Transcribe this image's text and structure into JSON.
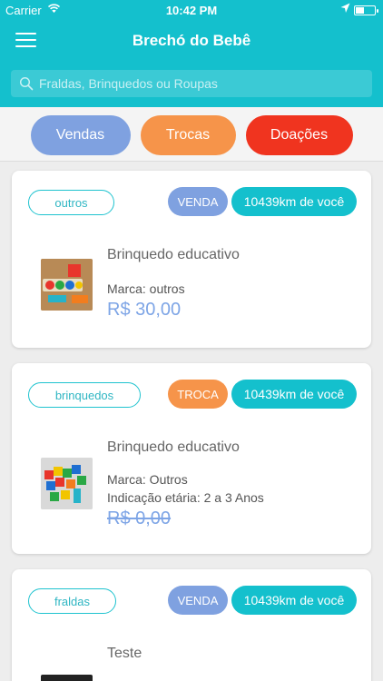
{
  "status_bar": {
    "carrier": "Carrier",
    "time": "10:42 PM"
  },
  "nav": {
    "title": "Brechó do Bebê",
    "menu_icon": "hamburger-menu-icon"
  },
  "search": {
    "placeholder": "Fraldas, Brinquedos ou Roupas",
    "value": ""
  },
  "filters": [
    {
      "label": "Vendas",
      "color": "#7fa1e0"
    },
    {
      "label": "Trocas",
      "color": "#f6944a"
    },
    {
      "label": "Doações",
      "color": "#f0341f"
    }
  ],
  "colors": {
    "accent": "#14c0cd",
    "venda": "#7fa1e0",
    "troca": "#f6944a",
    "price": "#7ea5e6"
  },
  "products": [
    {
      "category": "outros",
      "type": "VENDA",
      "distance": "10439km de você",
      "title": "Brinquedo educativo",
      "brand": "Marca: outros",
      "age": "",
      "price": "R$ 30,00"
    },
    {
      "category": "brinquedos",
      "type": "TROCA",
      "distance": "10439km de você",
      "title": "Brinquedo educativo",
      "brand": "Marca: Outros",
      "age": "Indicação etária: 2 a 3 Anos",
      "price": "R$ 0,00"
    },
    {
      "category": "fraldas",
      "type": "VENDA",
      "distance": "10439km de você",
      "title": "Teste",
      "brand": "",
      "age": "",
      "price": ""
    }
  ]
}
